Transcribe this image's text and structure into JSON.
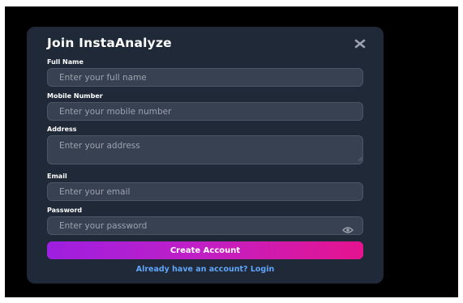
{
  "modal": {
    "title": "Join InstaAnalyze",
    "close_icon": "close-icon"
  },
  "fields": {
    "full_name": {
      "label": "Full Name",
      "placeholder": "Enter your full name",
      "value": ""
    },
    "mobile": {
      "label": "Mobile Number",
      "placeholder": "Enter your mobile number",
      "value": ""
    },
    "address": {
      "label": "Address",
      "placeholder": "Enter your address",
      "value": ""
    },
    "email": {
      "label": "Email",
      "placeholder": "Enter your email",
      "value": ""
    },
    "password": {
      "label": "Password",
      "placeholder": "Enter your password",
      "value": "",
      "toggle_icon": "eye-icon"
    }
  },
  "actions": {
    "submit_label": "Create Account",
    "login_link": "Already have an account? Login"
  },
  "colors": {
    "backdrop": "#000000",
    "modal_bg": "#1f2937",
    "input_bg": "#374151",
    "button_gradient_start": "#9d1fe0",
    "button_gradient_end": "#e5138f",
    "link": "#60a5fa"
  }
}
